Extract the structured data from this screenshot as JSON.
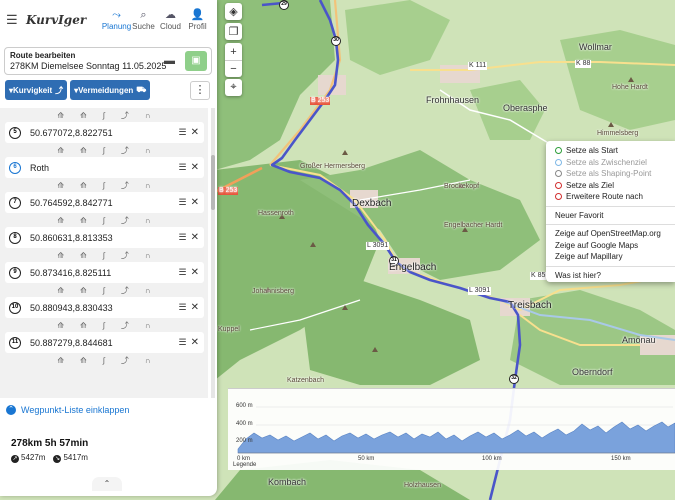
{
  "app": {
    "logo": "KurvIger",
    "nav": [
      {
        "label": "Planung",
        "icon": "route-icon"
      },
      {
        "label": "Suche",
        "icon": "search-icon"
      },
      {
        "label": "Cloud",
        "icon": "cloud-icon"
      },
      {
        "label": "Profil",
        "icon": "user-icon"
      }
    ]
  },
  "route": {
    "heading": "Route bearbeiten",
    "name": "278KM Diemelsee Sonntag 11.05.2025"
  },
  "chips": {
    "curviness": "Kurvigkeit",
    "avoidances": "Vermeidungen"
  },
  "waypoints": [
    {
      "num": "5",
      "label": "50.677072,8.822751",
      "via": false
    },
    {
      "num": "6",
      "label": "Roth",
      "via": true
    },
    {
      "num": "7",
      "label": "50.764592,8.842771",
      "via": false
    },
    {
      "num": "8",
      "label": "50.860631,8.813353",
      "via": false
    },
    {
      "num": "9",
      "label": "50.873416,8.825111",
      "via": false
    },
    {
      "num": "10",
      "label": "50.880943,8.830433",
      "via": false
    },
    {
      "num": "11",
      "label": "50.887279,8.844681",
      "via": false
    }
  ],
  "collapse_label": "Wegpunkt-Liste einklappen",
  "summary": {
    "stats": "278km  5h 57min",
    "ascent": "5427m",
    "descent": "5417m"
  },
  "context_menu": {
    "items": [
      {
        "label": "Setze als Start",
        "color": "#2e9e3a",
        "dim": false
      },
      {
        "label": "Setze als Zwischenziel",
        "color": "#7fb8e6",
        "dim": true
      },
      {
        "label": "Setze als Shaping-Point",
        "color": "#888888",
        "dim": true
      },
      {
        "label": "Setze als Ziel",
        "color": "#d22e2e",
        "dim": false
      },
      {
        "label": "Erweitere Route nach",
        "color": "#d22e2e",
        "dim": false
      }
    ],
    "favorite": "Neuer Favorit",
    "links": [
      "Zeige auf OpenStreetMap.org",
      "Zeige auf Google Maps",
      "Zeige auf Mapillary"
    ],
    "what": "Was ist hier?"
  },
  "map_labels": [
    {
      "text": "Wollmar"
    },
    {
      "text": "Frohnhausen"
    },
    {
      "text": "Oberasphe"
    },
    {
      "text": "Himmelsberg"
    },
    {
      "text": "Hohe Hardt"
    },
    {
      "text": "Großer Hermersberg"
    },
    {
      "text": "Dexbach"
    },
    {
      "text": "Engelbach"
    },
    {
      "text": "Brockekopf"
    },
    {
      "text": "Engelbacher Hardt"
    },
    {
      "text": "Hassenroth"
    },
    {
      "text": "Johannisberg"
    },
    {
      "text": "Treisbach"
    },
    {
      "text": "Oberndorf"
    },
    {
      "text": "Amönau"
    },
    {
      "text": "Kombach"
    },
    {
      "text": "Holzhausen"
    },
    {
      "text": "Kuppel"
    },
    {
      "text": "Katzenbach"
    }
  ],
  "road_labels": [
    "L 3091",
    "L 3091",
    "K 111",
    "K 88",
    "K 85",
    "B 253",
    "B 253"
  ],
  "elevation": {
    "y_ticks": [
      "600 m",
      "400 m",
      "200 m"
    ],
    "x_ticks": [
      "0 km",
      "50 km",
      "100 km",
      "150 km"
    ],
    "legend": "Legende"
  },
  "colors": {
    "accent": "#1976d2",
    "chip": "#2f6db3",
    "route": "#4a55c9",
    "forest": "#8fbf7a",
    "save": "#8fcf8a"
  }
}
